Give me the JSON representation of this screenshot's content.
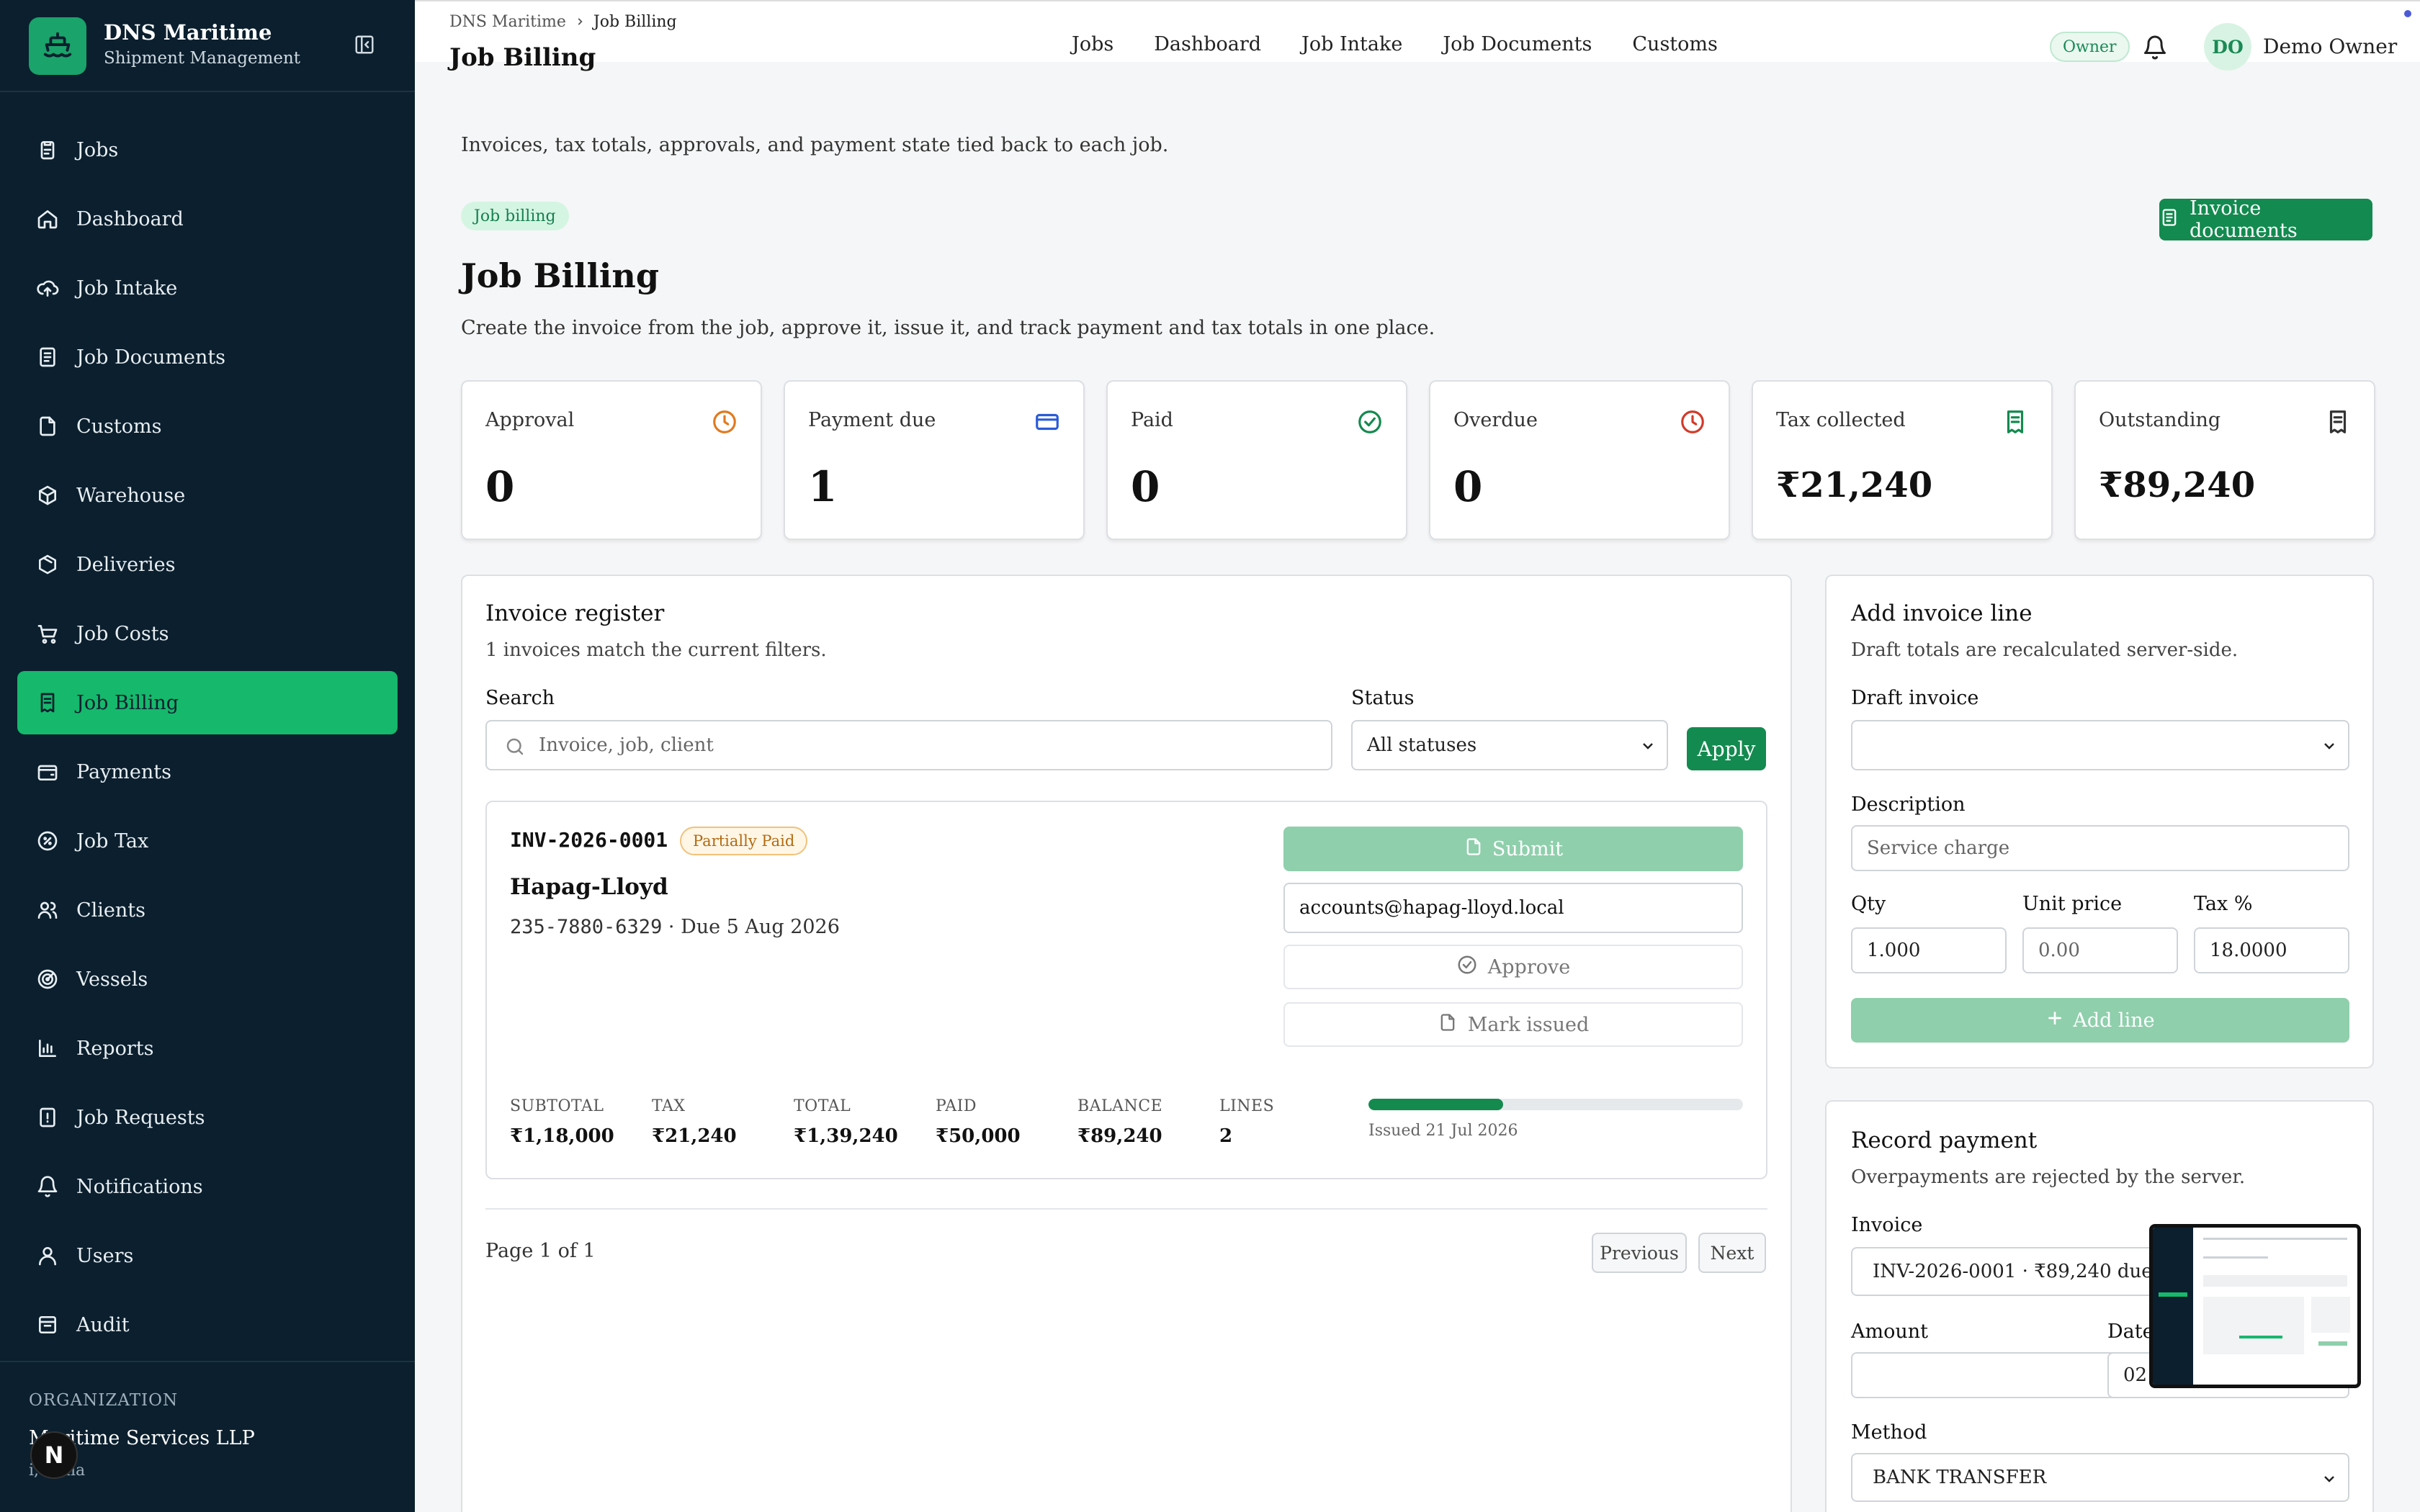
{
  "brand": {
    "name": "DNS Maritime",
    "subtitle": "Shipment Management"
  },
  "sidebar": {
    "items": [
      {
        "label": "Jobs",
        "icon": "clipboard-icon"
      },
      {
        "label": "Dashboard",
        "icon": "home-icon"
      },
      {
        "label": "Job Intake",
        "icon": "upload-cloud-icon"
      },
      {
        "label": "Job Documents",
        "icon": "document-icon"
      },
      {
        "label": "Customs",
        "icon": "file-icon"
      },
      {
        "label": "Warehouse",
        "icon": "package-icon"
      },
      {
        "label": "Deliveries",
        "icon": "box-icon"
      },
      {
        "label": "Job Costs",
        "icon": "cart-icon"
      },
      {
        "label": "Job Billing",
        "icon": "receipt-icon",
        "active": true
      },
      {
        "label": "Payments",
        "icon": "wallet-icon"
      },
      {
        "label": "Job Tax",
        "icon": "percent-icon"
      },
      {
        "label": "Clients",
        "icon": "users-icon"
      },
      {
        "label": "Vessels",
        "icon": "radar-icon"
      },
      {
        "label": "Reports",
        "icon": "bar-chart-icon"
      },
      {
        "label": "Job Requests",
        "icon": "alert-document-icon"
      },
      {
        "label": "Notifications",
        "icon": "bell-icon"
      },
      {
        "label": "Users",
        "icon": "user-icon"
      },
      {
        "label": "Audit",
        "icon": "archive-icon"
      }
    ],
    "org_label": "ORGANIZATION",
    "org_name": "Maritime Services LLP",
    "org_location": "i, India",
    "n_badge": "N"
  },
  "header": {
    "breadcrumb_root": "DNS Maritime",
    "breadcrumb_current": "Job Billing",
    "title": "Job Billing",
    "nav": [
      "Jobs",
      "Dashboard",
      "Job Intake",
      "Job Documents",
      "Customs"
    ],
    "role": "Owner",
    "avatar_initials": "DO",
    "user_name": "Demo Owner"
  },
  "page": {
    "intro": "Invoices, tax totals, approvals, and payment state tied back to each job.",
    "tag": "Job billing",
    "invoice_docs_button": "Invoice documents",
    "title": "Job Billing",
    "subtitle": "Create the invoice from the job, approve it, issue it, and track payment and tax totals in one place."
  },
  "stats": [
    {
      "label": "Approval",
      "value": "0",
      "icon": "clock-icon",
      "color": "#e07a1f"
    },
    {
      "label": "Payment due",
      "value": "1",
      "icon": "credit-card-icon",
      "color": "#2a5bd7"
    },
    {
      "label": "Paid",
      "value": "0",
      "icon": "check-circle-icon",
      "color": "#138a4f"
    },
    {
      "label": "Overdue",
      "value": "0",
      "icon": "clock-icon",
      "color": "#d23a2a"
    },
    {
      "label": "Tax collected",
      "value": "₹21,240",
      "icon": "receipt-icon",
      "color": "#138a4f"
    },
    {
      "label": "Outstanding",
      "value": "₹89,240",
      "icon": "receipt-icon",
      "color": "#333333"
    }
  ],
  "register": {
    "title": "Invoice register",
    "subtitle": "1 invoices match the current filters.",
    "search_label": "Search",
    "search_placeholder": "Invoice, job, client",
    "status_label": "Status",
    "status_value": "All statuses",
    "apply": "Apply",
    "invoice": {
      "number": "INV-2026-0001",
      "status": "Partially Paid",
      "client": "Hapag-Lloyd",
      "job_no": "235-7880-6329",
      "due": " · Due 5 Aug 2026",
      "submit": "Submit",
      "email": "accounts@hapag-lloyd.local",
      "approve": "Approve",
      "mark_issued": "Mark issued",
      "totals": [
        {
          "k": "SUBTOTAL",
          "v": "₹1,18,000"
        },
        {
          "k": "TAX",
          "v": "₹21,240"
        },
        {
          "k": "TOTAL",
          "v": "₹1,39,240"
        },
        {
          "k": "PAID",
          "v": "₹50,000"
        },
        {
          "k": "BALANCE",
          "v": "₹89,240"
        },
        {
          "k": "LINES",
          "v": "2"
        }
      ],
      "paid_fraction": 0.36,
      "issued": "Issued 21 Jul 2026"
    },
    "page_text": "Page 1 of 1",
    "prev": "Previous",
    "next": "Next"
  },
  "add_line": {
    "title": "Add invoice line",
    "subtitle": "Draft totals are recalculated server-side.",
    "draft_label": "Draft invoice",
    "draft_value": "",
    "desc_label": "Description",
    "desc_placeholder": "Service charge",
    "qty_label": "Qty",
    "qty_value": "1.000",
    "unit_label": "Unit price",
    "unit_placeholder": "0.00",
    "tax_label": "Tax %",
    "tax_value": "18.0000",
    "button": "Add line"
  },
  "payment": {
    "title": "Record payment",
    "subtitle": "Overpayments are rejected by the server.",
    "invoice_label": "Invoice",
    "invoice_value": "INV-2026-0001 · ₹89,240 due",
    "amount_label": "Amount",
    "amount_value": "",
    "date_label": "Date",
    "date_value": "02",
    "method_label": "Method",
    "method_value": "BANK TRANSFER"
  }
}
